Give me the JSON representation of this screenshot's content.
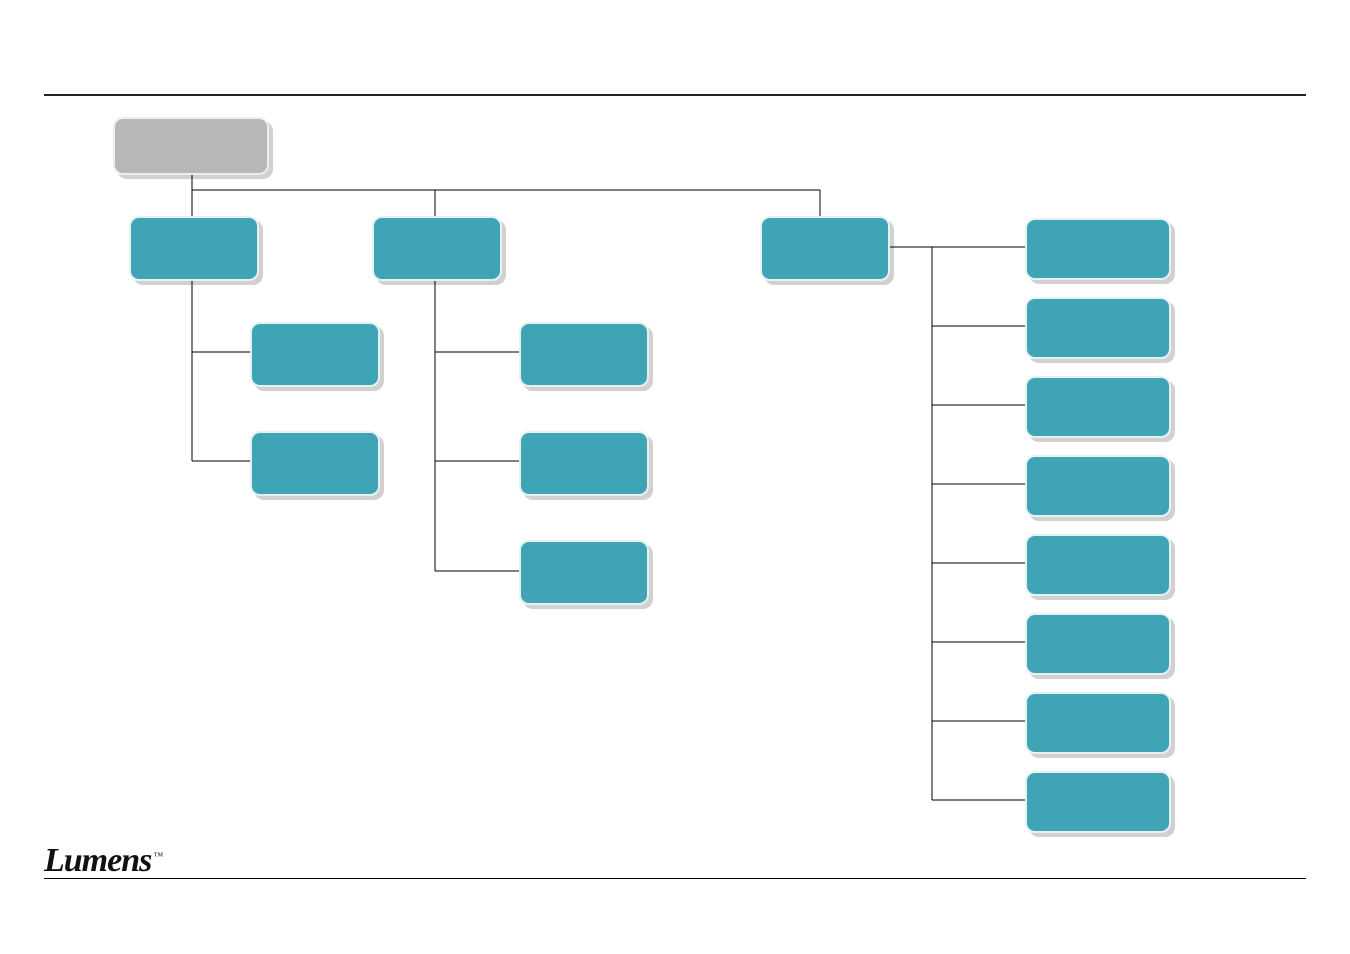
{
  "brand": "Lumens",
  "trademark": "™",
  "nodes": {
    "root": "",
    "a": "",
    "a1": "",
    "a2": "",
    "b": "",
    "b1": "",
    "b2": "",
    "b3": "",
    "c": "",
    "d1": "",
    "d2": "",
    "d3": "",
    "d4": "",
    "d5": "",
    "d6": "",
    "d7": "",
    "d8": ""
  },
  "colors": {
    "node": "#3fa4b6",
    "root": "#b8b8b8",
    "border": "#e6f1f4"
  }
}
